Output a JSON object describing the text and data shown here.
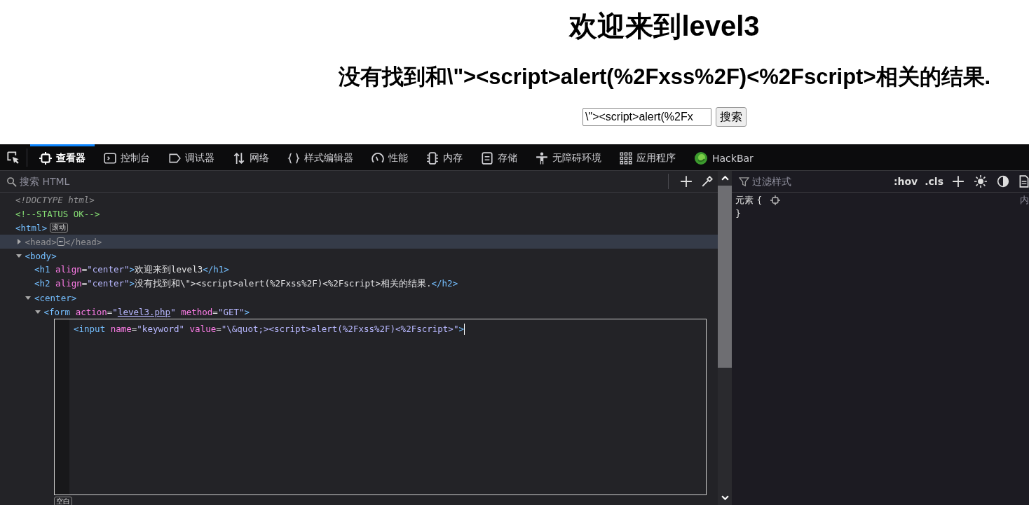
{
  "page": {
    "heading": "欢迎来到level3",
    "subheading": "没有找到和\\\"><script>alert(%2Fxss%2F)<%2Fscript>相关的结果.",
    "search_value": "\\\"><script>alert(%2Fx",
    "search_button": "搜索"
  },
  "devtools": {
    "tabs": [
      {
        "label": "查看器",
        "selected": true
      },
      {
        "label": "控制台",
        "selected": false
      },
      {
        "label": "调试器",
        "selected": false
      },
      {
        "label": "网络",
        "selected": false
      },
      {
        "label": "样式编辑器",
        "selected": false
      },
      {
        "label": "性能",
        "selected": false
      },
      {
        "label": "内存",
        "selected": false
      },
      {
        "label": "存储",
        "selected": false
      },
      {
        "label": "无障碍环境",
        "selected": false
      },
      {
        "label": "应用程序",
        "selected": false
      },
      {
        "label": "HackBar",
        "selected": false
      }
    ],
    "search_placeholder": "搜索 HTML",
    "tree": [
      {
        "tokens": [
          {
            "doctype": "<!DOCTYPE html>"
          }
        ]
      },
      {
        "tokens": [
          {
            "comment": "<!--STATUS OK-->"
          }
        ]
      },
      {
        "tokens": [
          {
            "tag": "<html>"
          }
        ],
        "badge": "滚动",
        "children": [
          {
            "tokens": [
              {
                "dim": "<head>"
              }
            ],
            "dots": "⋯",
            "after": [
              {
                "dim": "</head>"
              }
            ],
            "expanded": false,
            "selected": true
          },
          {
            "tokens": [
              {
                "tag": "<body>"
              }
            ],
            "expanded": true,
            "selected": false,
            "children": [
              {
                "tokens": [
                  {
                    "tag": "<h1 "
                  },
                  {
                    "attr": "align"
                  },
                  {
                    "eq": "="
                  },
                  {
                    "val": "\"center\""
                  },
                  {
                    "tag": ">"
                  },
                  {
                    "text": "欢迎来到level3"
                  },
                  {
                    "tag": "</h1>"
                  }
                ]
              },
              {
                "tokens": [
                  {
                    "tag": "<h2 "
                  },
                  {
                    "attr": "align"
                  },
                  {
                    "eq": "="
                  },
                  {
                    "val": "\"center\""
                  },
                  {
                    "tag": ">"
                  },
                  {
                    "text": "没有找到和\\\"><script>alert(%2Fxss%2F)<%2Fscript>相关的结果."
                  },
                  {
                    "tag": "</h2>"
                  }
                ]
              },
              {
                "tokens": [
                  {
                    "tag": "<center>"
                  }
                ],
                "expanded": true,
                "selected": false,
                "children": [
                  {
                    "tokens": [
                      {
                        "tag": "<form "
                      },
                      {
                        "attr": "action"
                      },
                      {
                        "eq": "="
                      },
                      {
                        "val": "\""
                      },
                      {
                        "link": "level3.php"
                      },
                      {
                        "val": "\""
                      },
                      {
                        "attr": " method"
                      },
                      {
                        "eq": "="
                      },
                      {
                        "val": "\"GET\""
                      },
                      {
                        "tag": ">"
                      }
                    ],
                    "expanded": true,
                    "selected": false,
                    "children": [
                      {
                        "kind": "editor",
                        "tokens": [
                          {
                            "tag": "<input "
                          },
                          {
                            "attr": "name"
                          },
                          {
                            "eq": "="
                          },
                          {
                            "val": "\"keyword\""
                          },
                          {
                            "attr": " value"
                          },
                          {
                            "eq": "="
                          },
                          {
                            "val": "\"\\&quot;><script>alert(%2Fxss%2F)<%2Fscript>\""
                          },
                          {
                            "tag": ">"
                          }
                        ],
                        "badge": "空白"
                      }
                    ]
                  }
                ]
              }
            ]
          }
        ]
      }
    ],
    "styles": {
      "filter_placeholder": "过滤样式",
      "hov": ":hov",
      "cls": ".cls",
      "rule_selector": "元素 {",
      "rule_close": "}",
      "source": "内"
    }
  }
}
